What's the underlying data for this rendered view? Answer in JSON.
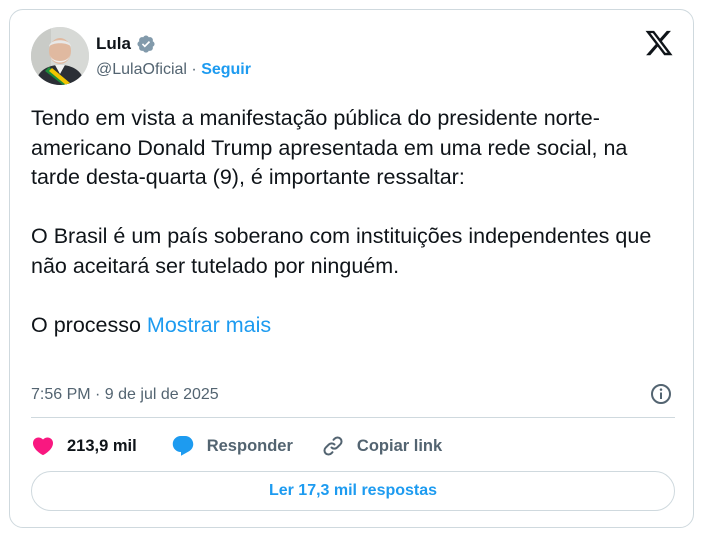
{
  "author": {
    "name": "Lula",
    "handle": "@LulaOficial",
    "separator": "·",
    "follow_label": "Seguir"
  },
  "icons": {
    "verified": "verified-badge-icon",
    "brand": "x-logo-icon",
    "info": "info-icon",
    "like": "heart-icon",
    "reply": "speech-bubble-icon",
    "copy_link": "link-icon"
  },
  "tweet": {
    "paragraphs": [
      "Tendo em vista a manifestação pública do presidente norte-americano Donald Trump apresentada em uma rede social, na tarde desta-quarta (9), é importante ressaltar:",
      "O Brasil é um país soberano com instituições independentes que não aceitará ser tutelado por ninguém.",
      "O processo"
    ],
    "show_more_label": "Mostrar mais",
    "timestamp": "7:56 PM · 9 de jul de 2025"
  },
  "actions": {
    "likes": "213,9 mil",
    "reply_label": "Responder",
    "copy_link_label": "Copiar link"
  },
  "footer": {
    "read_replies_label": "Ler 17,3 mil respostas"
  },
  "colors": {
    "accent": "#1d9bf0",
    "like": "#f91880",
    "text": "#0f1419",
    "secondary_text": "#536471",
    "border": "#cfd9de"
  }
}
